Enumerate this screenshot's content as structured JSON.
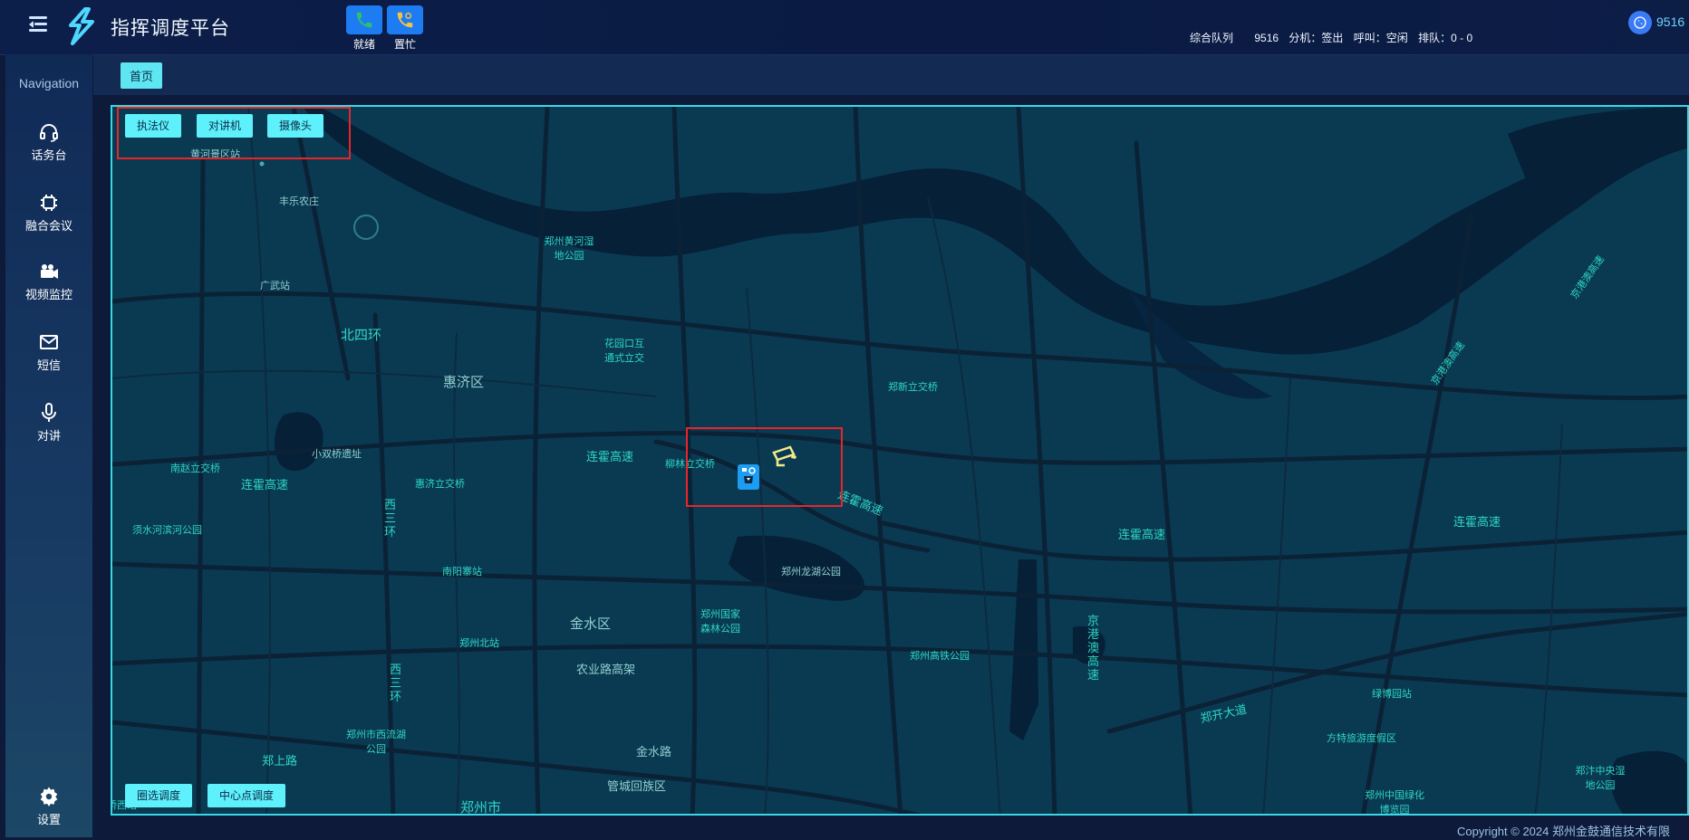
{
  "app": {
    "title": "指挥调度平台"
  },
  "phone_buttons": [
    {
      "label": "就绪",
      "icon": "phone-icon",
      "color": "#2ec26b"
    },
    {
      "label": "置忙",
      "icon": "phone-busy-icon",
      "color": "#f5c541"
    }
  ],
  "status_bar": {
    "queue_label": "综合队列",
    "extension_number": "9516",
    "extension_state": "分机：签出",
    "call_state": "呼叫：空闲",
    "queue_state": "排队：0 - 0"
  },
  "user": {
    "id": "9516",
    "icon": "whatsapp-phone-icon"
  },
  "navigation": {
    "title": "Navigation",
    "items": [
      {
        "label": "话务台",
        "icon": "headset-icon"
      },
      {
        "label": "融合会议",
        "icon": "chip-icon"
      },
      {
        "label": "视频监控",
        "icon": "video-camera-icon"
      },
      {
        "label": "短信",
        "icon": "mail-icon"
      },
      {
        "label": "对讲",
        "icon": "microphone-icon"
      }
    ],
    "settings_label": "设置"
  },
  "breadcrumb": {
    "home": "首页"
  },
  "map": {
    "filter_buttons": [
      "执法仪",
      "对讲机",
      "摄像头"
    ],
    "dispatch_buttons": [
      "圈选调度",
      "中心点调度"
    ],
    "labels": [
      "黄河景区站",
      "丰乐农庄",
      "郑州黄河湿地公园",
      "广武站",
      "北四环",
      "惠济区",
      "花园口互通式立交",
      "郑新立交桥",
      "小双桥遗址",
      "南赵立交桥",
      "连霍高速",
      "惠济立交桥",
      "连霍高速",
      "柳林立交桥",
      "连霍高速",
      "连霍高速",
      "连霍高速",
      "西三环",
      "须水河滨河公园",
      "南阳寨站",
      "郑州龙湖公园",
      "金水区",
      "郑州国家森林公园",
      "郑州北站",
      "农业路高架",
      "郑州高铁公园",
      "京港澳高速",
      "西三环",
      "郑开大道",
      "绿博园站",
      "郑州市西流湖公园",
      "郑上路",
      "金水路",
      "方特旅游度假区",
      "管城回族区",
      "郑州市",
      "郑州中国绿化博览园",
      "郑汴中央湿地公园",
      "京港澳高速",
      "京港澳高速",
      "桥西站"
    ],
    "markers": [
      {
        "type": "police-device",
        "icon": "body-camera-icon"
      },
      {
        "type": "camera",
        "icon": "cctv-camera-icon"
      }
    ],
    "colors": {
      "land": "#0a3a52",
      "water": "#062038",
      "road": "#0b2236",
      "accent": "#5ef0fb",
      "highlight": "#e8262a"
    }
  },
  "footer": {
    "copyright": "Copyright © 2024 郑州金鼓通信技术有限"
  }
}
